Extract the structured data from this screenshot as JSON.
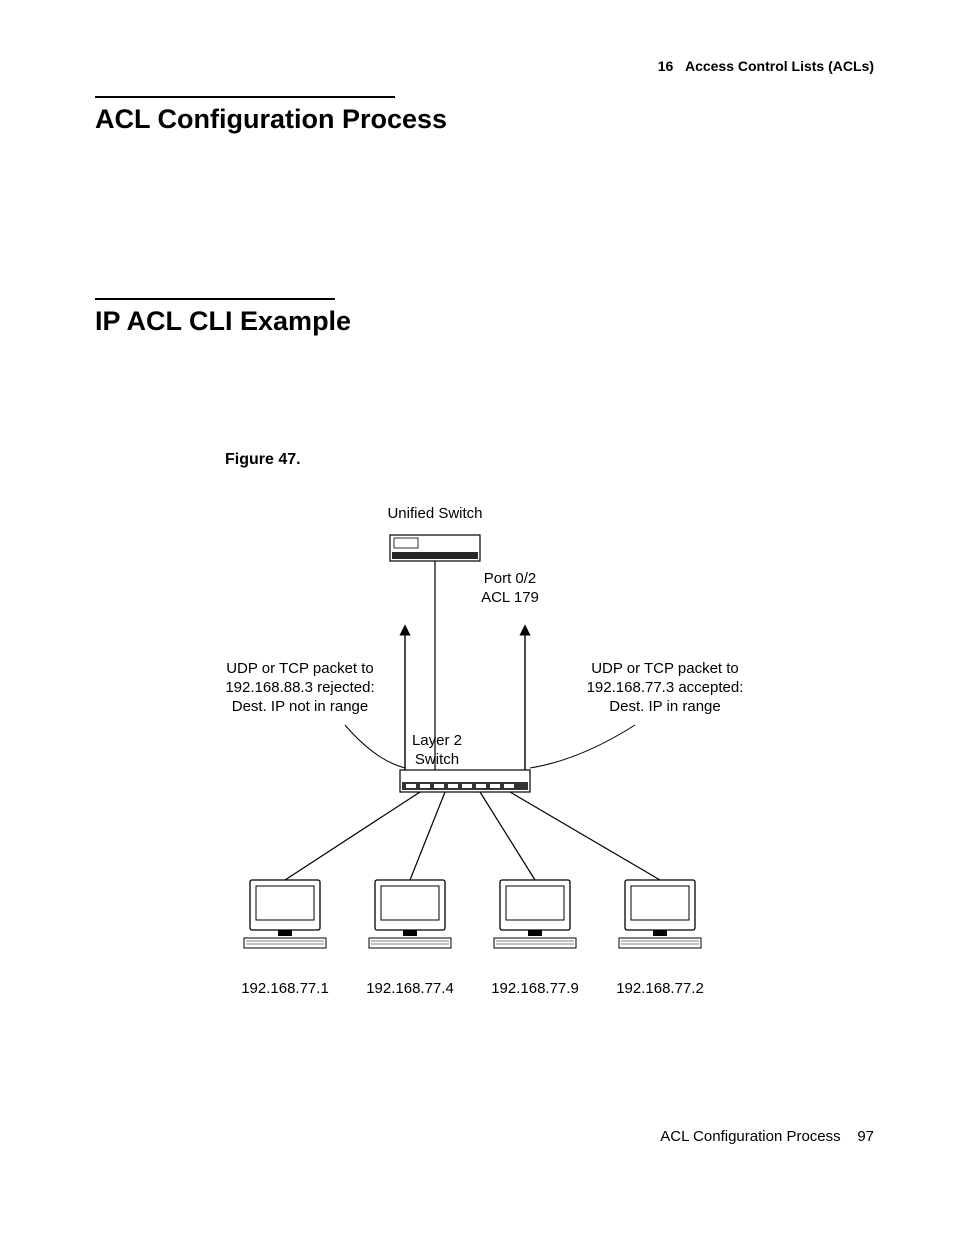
{
  "header": {
    "chapter_num": "16",
    "chapter_title": "Access Control Lists (ACLs)"
  },
  "sections": {
    "s1_title": "ACL Configuration Process",
    "s2_title": "IP ACL CLI Example"
  },
  "figure": {
    "label": "Figure 47.",
    "top_label": "Unified Switch",
    "port_label1": "Port 0/2",
    "port_label2": "ACL 179",
    "left_note_l1": "UDP or TCP packet to",
    "left_note_l2": "192.168.88.3 rejected:",
    "left_note_l3": "Dest. IP not in range",
    "right_note_l1": "UDP or TCP packet to",
    "right_note_l2": "192.168.77.3 accepted:",
    "right_note_l3": "Dest. IP in range",
    "mid_label_l1": "Layer 2",
    "mid_label_l2": "Switch",
    "hosts": {
      "h1": "192.168.77.1",
      "h2": "192.168.77.4",
      "h3": "192.168.77.9",
      "h4": "192.168.77.2"
    }
  },
  "footer": {
    "section": "ACL Configuration Process",
    "page": "97"
  }
}
